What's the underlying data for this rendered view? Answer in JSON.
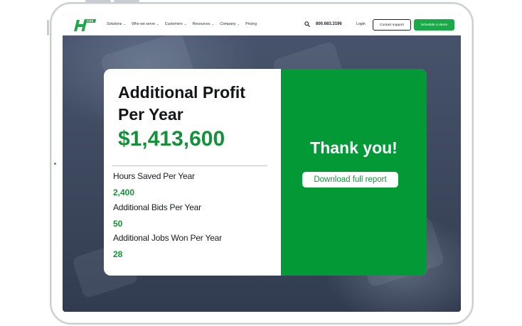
{
  "nav": {
    "menu": [
      {
        "label": "Solutions",
        "has_dropdown": true
      },
      {
        "label": "Who we serve",
        "has_dropdown": true
      },
      {
        "label": "Customers",
        "has_dropdown": true
      },
      {
        "label": "Resources",
        "has_dropdown": true
      },
      {
        "label": "Company",
        "has_dropdown": true
      },
      {
        "label": "Pricing",
        "has_dropdown": false
      }
    ],
    "chevron": "⌄",
    "phone": "800.683.3196",
    "login": "Login",
    "contact_button": "Contact support",
    "demo_button": "Schedule a demo",
    "icons": {
      "logo": "hcss-logo",
      "search": "search-icon"
    }
  },
  "results": {
    "title": "Additional Profit Per Year",
    "profit": "$1,413,600",
    "metrics": [
      {
        "label": "Hours Saved Per Year",
        "value": "2,400"
      },
      {
        "label": "Additional Bids Per Year",
        "value": "50"
      },
      {
        "label": "Additional Jobs Won Per Year",
        "value": "28"
      }
    ]
  },
  "thank_you": {
    "heading": "Thank you!",
    "download_button": "Download full report"
  },
  "colors": {
    "brand_green": "#029936",
    "value_green": "#13923a",
    "button_green": "#1da84a",
    "background": "#3f4a5f"
  }
}
